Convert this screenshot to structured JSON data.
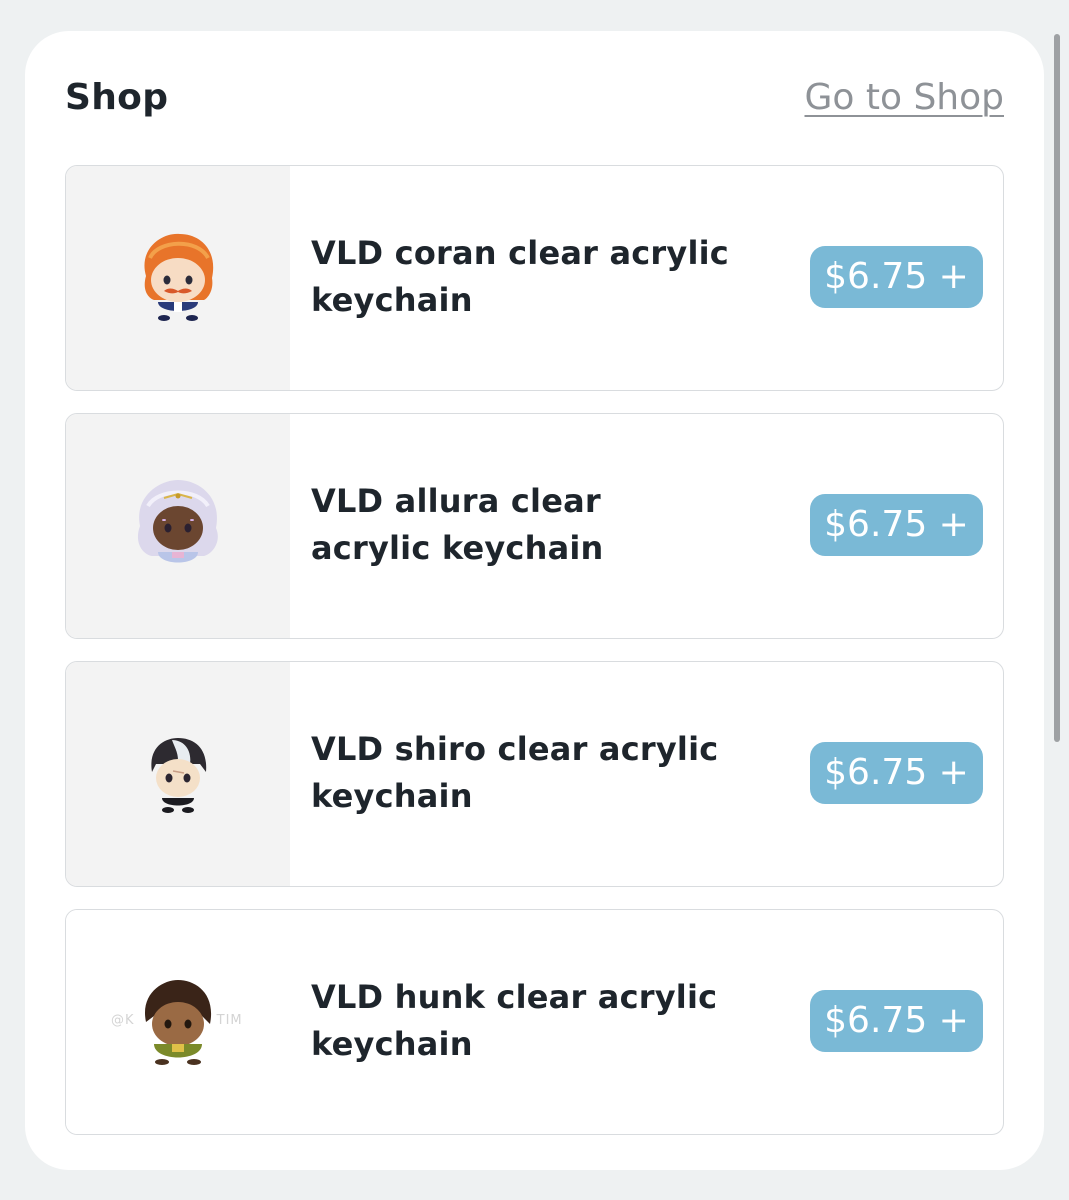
{
  "shop": {
    "title": "Shop",
    "go_to_shop": "Go to Shop"
  },
  "items": [
    {
      "name": "VLD coran clear acrylic keychain",
      "price": "$6.75 +",
      "thumb_icon": "coran-chibi-keychain"
    },
    {
      "name": "VLD allura clear acrylic keychain",
      "price": "$6.75 +",
      "thumb_icon": "allura-chibi-keychain"
    },
    {
      "name": "VLD shiro clear acrylic keychain",
      "price": "$6.75 +",
      "thumb_icon": "shiro-chibi-keychain"
    },
    {
      "name": "VLD hunk clear acrylic keychain",
      "price": "$6.75 +",
      "thumb_icon": "hunk-chibi-keychain"
    }
  ],
  "colors": {
    "page_bg": "#eef1f2",
    "card_bg": "#ffffff",
    "price_badge": "#7ab9d6",
    "thumb_bg": "#f3f3f3"
  }
}
